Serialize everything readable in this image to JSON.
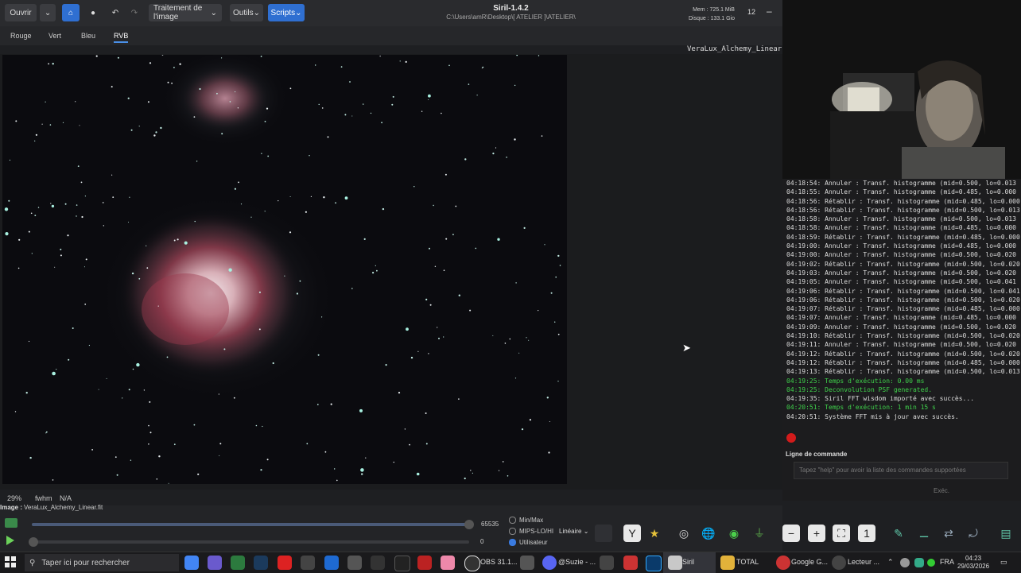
{
  "toolbar": {
    "open_label": "Ouvrir",
    "image_processing_label": "Traitement de l'image",
    "tools_label": "Outils",
    "scripts_label": "Scripts",
    "app_title": "Siril-1.4.2",
    "path": "C:\\Users\\amR\\Desktop\\[ ATELIER ]\\ATELIER\\",
    "memory": "Mem : 725.1 MiB",
    "disk": "Disque : 133.1 Gio",
    "thread_count": "12",
    "minimize": "–"
  },
  "channels": {
    "tabs": [
      "Rouge",
      "Vert",
      "Bleu",
      "RVB"
    ],
    "active": "RVB"
  },
  "viewer": {
    "filename": "VeraLux_Alchemy_Linear.fit"
  },
  "status": {
    "zoom": "29%",
    "fwhm_label": "fwhm",
    "fwhm_value": "N/A",
    "image_label": "Image :",
    "image_name": "VeraLux_Alchemy_Linear.fit"
  },
  "bottom": {
    "high_value": "65535",
    "low_value": "0",
    "options": [
      "Min/Max",
      "MIPS-LO/HI",
      "Utilisateur"
    ],
    "selected_option": "Utilisateur",
    "stretch_mode": "Linéaire"
  },
  "console": {
    "lines": [
      {
        "t": "04:18:54: Annuler : Transf. histogramme (mid=0.500, lo=0.013",
        "green": false
      },
      {
        "t": "04:18:55: Annuler : Transf. histogramme (mid=0.485, lo=0.000",
        "green": false
      },
      {
        "t": "04:18:56: Rétablir : Transf. histogramme (mid=0.485, lo=0.000",
        "green": false
      },
      {
        "t": "04:18:56: Rétablir : Transf. histogramme (mid=0.500, lo=0.013",
        "green": false
      },
      {
        "t": "04:18:58: Annuler : Transf. histogramme (mid=0.500, lo=0.013",
        "green": false
      },
      {
        "t": "04:18:58: Annuler : Transf. histogramme (mid=0.485, lo=0.000",
        "green": false
      },
      {
        "t": "04:18:59: Rétablir : Transf. histogramme (mid=0.485, lo=0.000",
        "green": false
      },
      {
        "t": "04:19:00: Annuler : Transf. histogramme (mid=0.485, lo=0.000",
        "green": false
      },
      {
        "t": "04:19:00: Annuler : Transf. histogramme (mid=0.500, lo=0.020",
        "green": false
      },
      {
        "t": "04:19:02: Rétablir : Transf. histogramme (mid=0.500, lo=0.020",
        "green": false
      },
      {
        "t": "04:19:03: Annuler : Transf. histogramme (mid=0.500, lo=0.020",
        "green": false
      },
      {
        "t": "04:19:05: Annuler : Transf. histogramme (mid=0.500, lo=0.041",
        "green": false
      },
      {
        "t": "04:19:06: Rétablir : Transf. histogramme (mid=0.500, lo=0.041",
        "green": false
      },
      {
        "t": "04:19:06: Rétablir : Transf. histogramme (mid=0.500, lo=0.020",
        "green": false
      },
      {
        "t": "04:19:07: Rétablir : Transf. histogramme (mid=0.485, lo=0.000",
        "green": false
      },
      {
        "t": "04:19:07: Annuler : Transf. histogramme (mid=0.485, lo=0.000",
        "green": false
      },
      {
        "t": "04:19:09: Annuler : Transf. histogramme (mid=0.500, lo=0.020",
        "green": false
      },
      {
        "t": "04:19:10: Rétablir : Transf. histogramme (mid=0.500, lo=0.020",
        "green": false
      },
      {
        "t": "04:19:11: Annuler : Transf. histogramme (mid=0.500, lo=0.020",
        "green": false
      },
      {
        "t": "04:19:12: Rétablir : Transf. histogramme (mid=0.500, lo=0.020",
        "green": false
      },
      {
        "t": "04:19:12: Rétablir : Transf. histogramme (mid=0.485, lo=0.000",
        "green": false
      },
      {
        "t": "04:19:13: Rétablir : Transf. histogramme (mid=0.500, lo=0.013",
        "green": false
      },
      {
        "t": "04:19:25: Temps d'exécution: 0.00 ms",
        "green": true
      },
      {
        "t": "04:19:25: Deconvolution PSF generated.",
        "green": true
      },
      {
        "t": "04:19:35: Siril FFT wisdom importé avec succès...",
        "green": false
      },
      {
        "t": "04:20:51: Temps d'exécution: 1 min 15 s",
        "green": true
      },
      {
        "t": "04:20:51: Système FFT mis à jour avec succès.",
        "green": false
      }
    ],
    "command_label": "Ligne de commande",
    "command_placeholder": "Tapez \"help\" pour avoir la liste des commandes supportées",
    "exec_label": "Exéc."
  },
  "taskbar": {
    "search_placeholder": "Taper ici pour rechercher",
    "apps": [
      "OBS 31.1...",
      "@Suzie - ...",
      "Siril",
      "TOTAL",
      "Google G...",
      "Lecteur ..."
    ],
    "language": "FRA",
    "time": "04:23",
    "date": "29/03/2026"
  }
}
